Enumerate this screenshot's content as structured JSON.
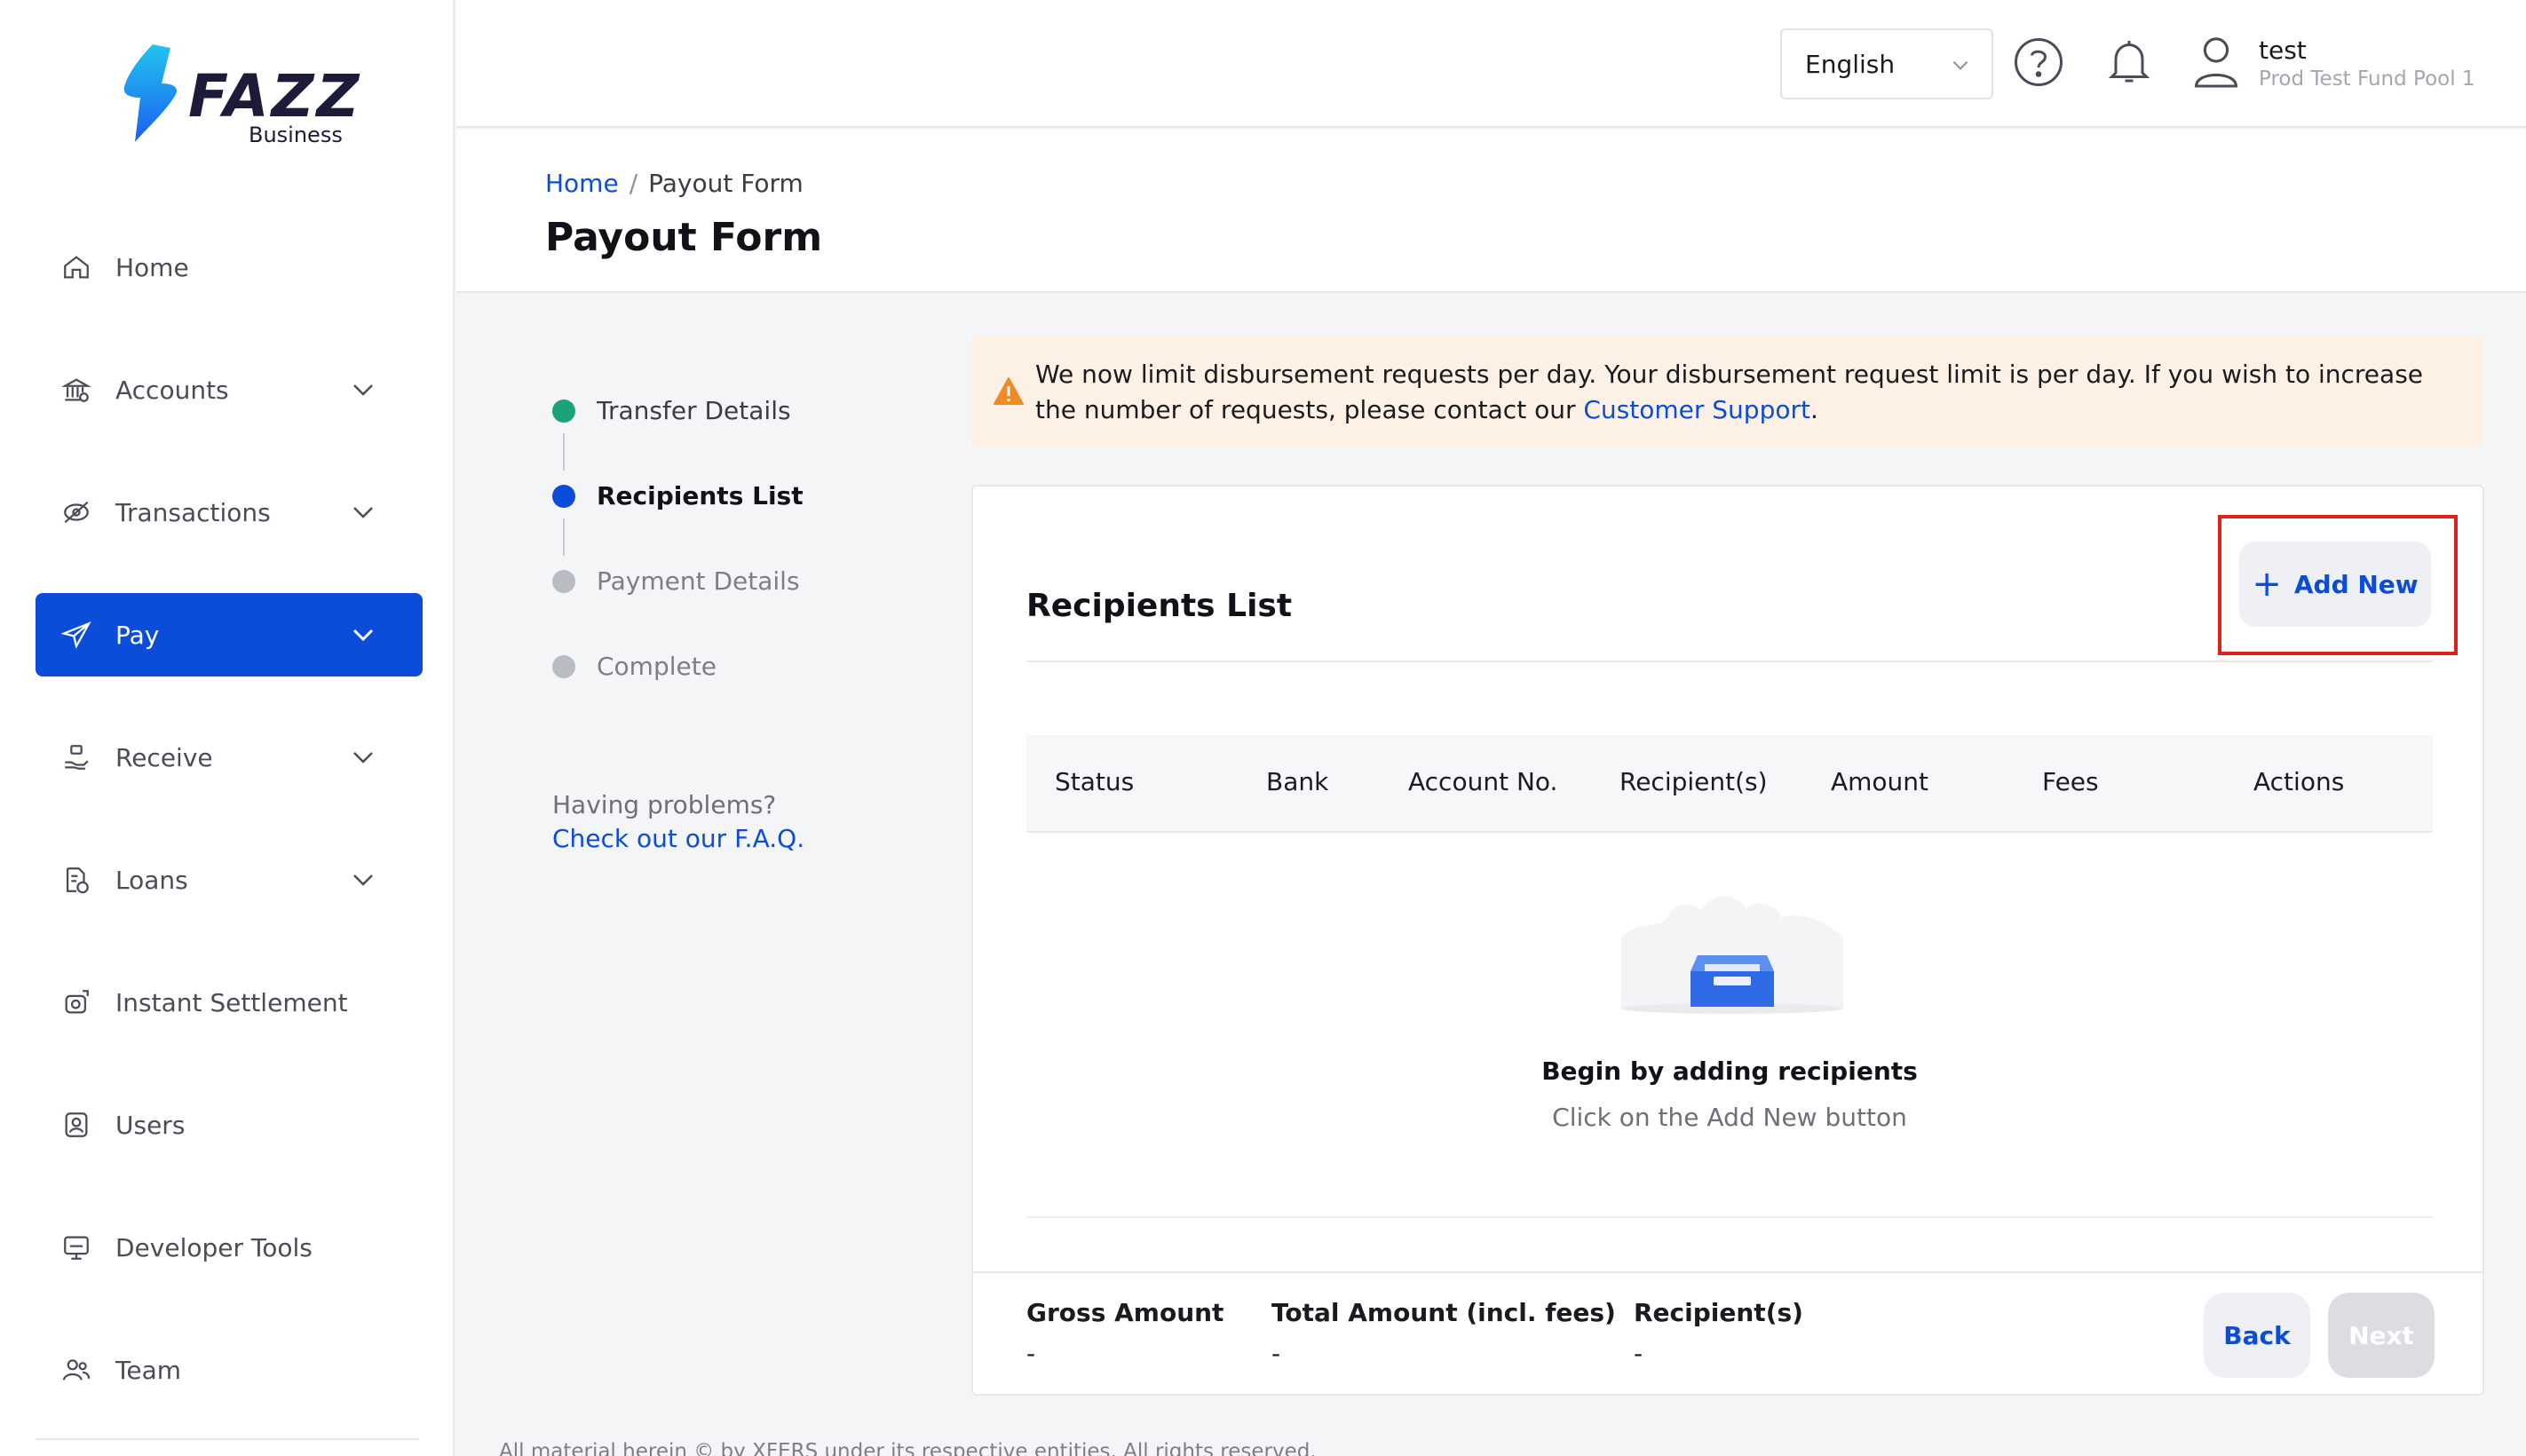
{
  "brand": {
    "name": "FAZZ",
    "subtitle": "Business",
    "accent": "#0b4dd8"
  },
  "sidebar": {
    "items": [
      {
        "label": "Home",
        "icon": "home-icon",
        "expandable": false
      },
      {
        "label": "Accounts",
        "icon": "bank-icon",
        "expandable": true
      },
      {
        "label": "Transactions",
        "icon": "transactions-icon",
        "expandable": true
      },
      {
        "label": "Pay",
        "icon": "paper-plane-icon",
        "expandable": true,
        "active": true
      },
      {
        "label": "Receive",
        "icon": "receive-hand-icon",
        "expandable": true
      },
      {
        "label": "Loans",
        "icon": "document-money-icon",
        "expandable": true
      },
      {
        "label": "Instant Settlement",
        "icon": "settlement-icon",
        "expandable": false
      },
      {
        "label": "Users",
        "icon": "users-icon",
        "expandable": false
      },
      {
        "label": "Developer Tools",
        "icon": "monitor-icon",
        "expandable": false
      },
      {
        "label": "Team",
        "icon": "team-icon",
        "expandable": false
      }
    ]
  },
  "header": {
    "language": "English",
    "user_name": "test",
    "user_org": "Prod Test Fund Pool 1"
  },
  "page": {
    "breadcrumb": {
      "home": "Home",
      "separator": "/",
      "current": "Payout Form"
    },
    "title": "Payout Form"
  },
  "stepper": {
    "steps": [
      {
        "label": "Transfer Details",
        "state": "done",
        "color": "#1aa37a"
      },
      {
        "label": "Recipients List",
        "state": "current",
        "color": "#0b4dd8"
      },
      {
        "label": "Payment Details",
        "state": "pending",
        "color": "#b9bcc3"
      },
      {
        "label": "Complete",
        "state": "pending",
        "color": "#b9bcc3"
      }
    ],
    "help_text": "Having problems?",
    "faq_link": "Check out our F.A.Q."
  },
  "alert": {
    "text_before": "We now limit disbursement requests per day. Your disbursement request limit is per day. If you wish to increase the number of requests, please contact our ",
    "link": "Customer Support",
    "text_after": "."
  },
  "recipients": {
    "title": "Recipients List",
    "add_new_label": "Add New",
    "columns": [
      "Status",
      "Bank",
      "Account No.",
      "Recipient(s)",
      "Amount",
      "Fees",
      "Actions"
    ],
    "empty_title": "Begin by adding recipients",
    "empty_subtitle": "Click on the Add New button"
  },
  "summary": {
    "gross_amount_label": "Gross Amount",
    "gross_amount_value": "-",
    "total_amount_label": "Total Amount (incl. fees)",
    "total_amount_value": "-",
    "recipients_label": "Recipient(s)",
    "recipients_value": "-",
    "back_label": "Back",
    "next_label": "Next"
  },
  "footer": {
    "text": "All material herein © by XFERS under its respective entities. All rights reserved."
  }
}
